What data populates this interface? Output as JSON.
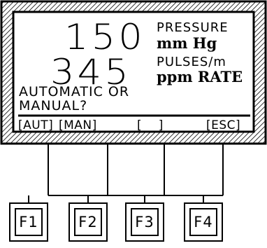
{
  "display": {
    "pressure_value": "150",
    "pressure_label": "PRESSURE",
    "pressure_unit": "mm Hg",
    "pulse_value": "345",
    "pulse_label": "PULSES/m",
    "pulse_unit": "ppm RATE",
    "prompt_line1": "AUTOMATIC OR",
    "prompt_line2": "MANUAL?",
    "softkeys": {
      "f1": "[AUT]",
      "f2": "[MAN]",
      "f3": "[    ]",
      "f4": "[ESC]"
    }
  },
  "function_keys": [
    {
      "label": "F1"
    },
    {
      "label": "F2"
    },
    {
      "label": "F3"
    },
    {
      "label": "F4"
    }
  ]
}
